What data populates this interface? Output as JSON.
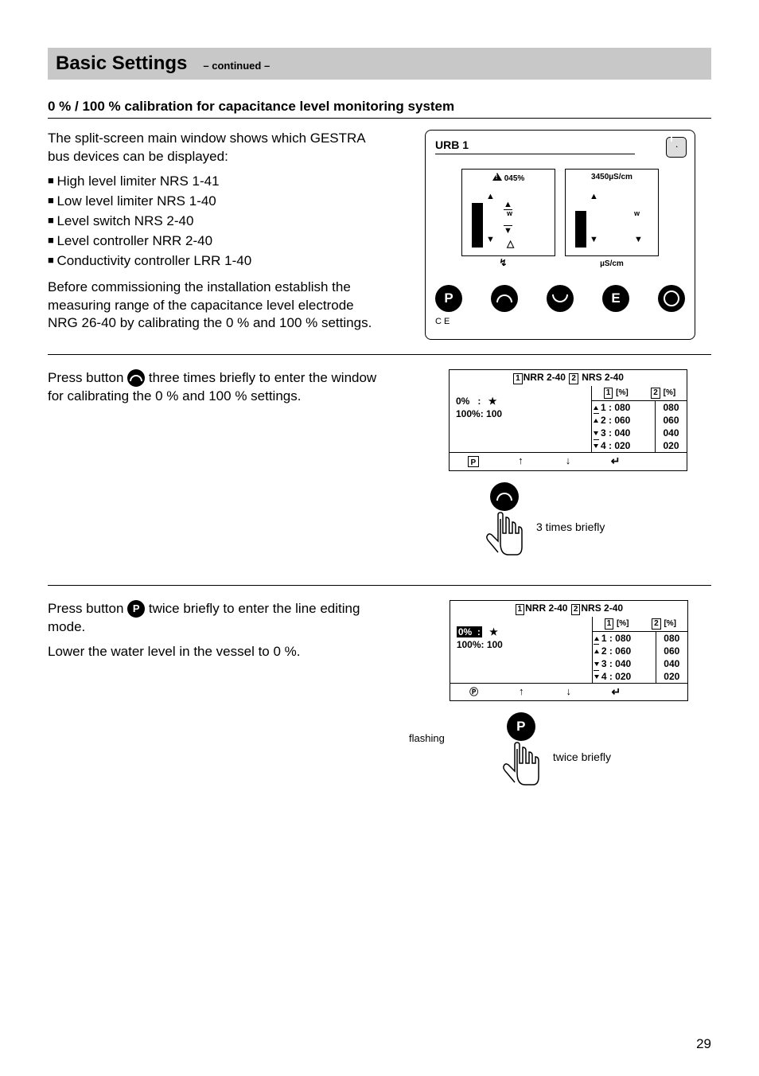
{
  "title": "Basic Settings",
  "continued": "– continued –",
  "subheading": "0 % / 100 % calibration for capacitance level monitoring system",
  "intro": {
    "p1": "The split-screen main window shows which GESTRA bus devices can be displayed:",
    "items": [
      "High level limiter NRS 1-41",
      "Low level limiter NRS 1-40",
      "Level switch NRS 2-40",
      "Level controller NRR 2-40",
      "Conductivity controller LRR 1-40"
    ],
    "p2": "Before commissioning the installation establish the measuring range of the capacitance level electrode NRG 26-40 by calibrating the 0 % and 100 % settings."
  },
  "urb": {
    "title": "URB 1",
    "left_value": "045%",
    "right_value": "3450µS/cm",
    "right_unit_bottom": "µS/cm",
    "w": "w",
    "ce": "C E"
  },
  "step2": {
    "text_a": "Press button ",
    "text_b": " three times briefly to enter the window for calibrating the 0 % and 100 % settings.",
    "hand_label": "3 times briefly"
  },
  "step3": {
    "text_a": "Press button ",
    "text_b": " twice briefly to enter the line editing mode.",
    "text_c": "Lower the water level in the vessel to 0 %.",
    "flashing": "flashing",
    "hand_label": "twice briefly"
  },
  "lcd": {
    "header_1": "NRR 2-40",
    "header_2": "NRS 2-40",
    "row0_label": "0%",
    "row0_colon": ":",
    "row0_star": "★",
    "row1": "100%:  100",
    "col1_head": "[%]",
    "col2_head": "[%]",
    "rows": [
      {
        "label": "1 : 080",
        "v": "080"
      },
      {
        "label": "2 : 060",
        "v": "060"
      },
      {
        "label": "3 : 040",
        "v": "040"
      },
      {
        "label": "4 : 020",
        "v": "020"
      }
    ],
    "footer_p": "P",
    "footer_up": "↑",
    "footer_dn": "↓",
    "footer_enter": "↵"
  },
  "page_number": "29"
}
